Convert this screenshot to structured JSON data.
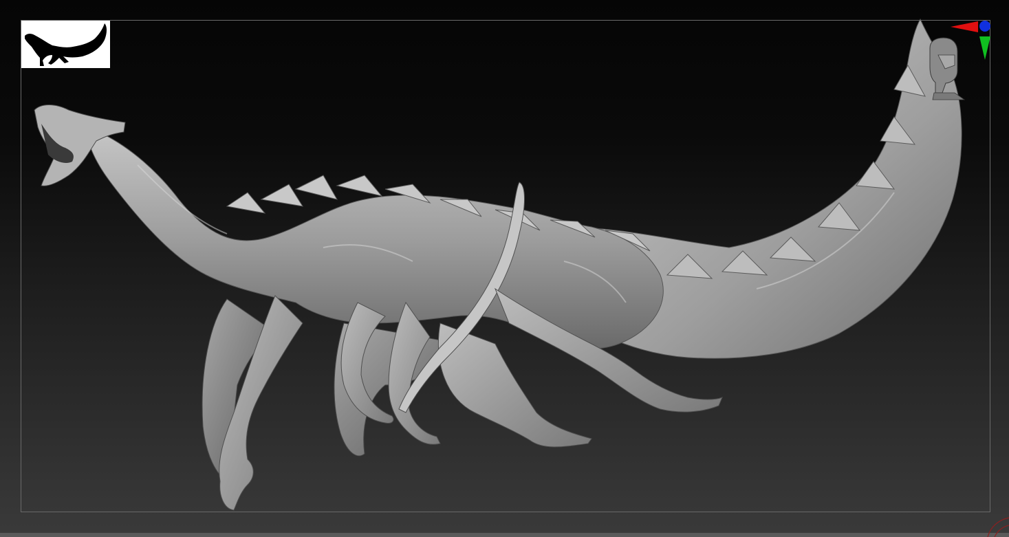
{
  "app": {
    "type": "3d-sculpting-viewport"
  },
  "viewport": {
    "background_top": "#050505",
    "background_bottom": "#3a3a3a",
    "frame_color": "#6a6a6a"
  },
  "thumbnail": {
    "icon": "dragon-silhouette-icon",
    "background": "#ffffff",
    "foreground": "#000000"
  },
  "model": {
    "icon": "dragon-sculpt-model",
    "material_color": "#9a9a9a"
  },
  "navigation_gizmo": {
    "icon": "head-orientation-icon",
    "axis_colors": {
      "x": "#e01010",
      "y": "#10c020",
      "z": "#1030e0"
    }
  },
  "corner_indicator": {
    "icon": "rotate-arc-icon",
    "color": "#8a2020"
  }
}
